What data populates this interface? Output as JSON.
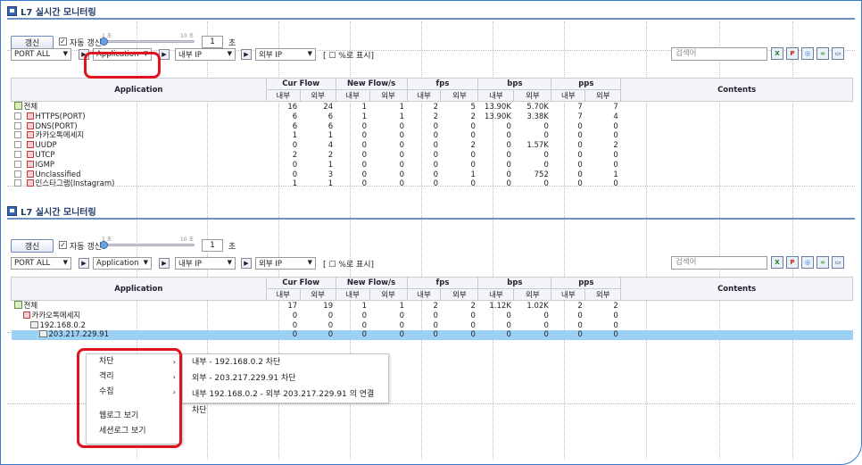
{
  "panel_title": "L7 실시간 모니터링",
  "refresh": {
    "button": "갱신",
    "auto_checkbox": "자동 갱신",
    "slider_min": "1 초",
    "slider_max": "10 초",
    "interval_value": "1",
    "interval_unit": "초"
  },
  "filters": {
    "port": "PORT ALL",
    "application": "Application",
    "internal_ip": "내부 IP",
    "external_ip": "외부 IP",
    "percent_label": "[ ☐ %로 표시]",
    "search_placeholder": "검색어"
  },
  "table_headers": {
    "application": "Application",
    "cur_flow": "Cur Flow",
    "new_flow": "New Flow/s",
    "fps": "fps",
    "bps": "bps",
    "pps": "pps",
    "contents": "Contents",
    "internal": "내부",
    "external": "외부"
  },
  "top_rows": [
    {
      "name": "전체",
      "cells": [
        "16",
        "24",
        "1",
        "1",
        "2",
        "5",
        "13.90K",
        "5.70K",
        "7",
        "7"
      ]
    },
    {
      "name": "HTTPS(PORT)",
      "cells": [
        "6",
        "6",
        "1",
        "1",
        "2",
        "2",
        "13.90K",
        "3.38K",
        "7",
        "4"
      ]
    },
    {
      "name": "DNS(PORT)",
      "cells": [
        "6",
        "6",
        "0",
        "0",
        "0",
        "0",
        "0",
        "0",
        "0",
        "0"
      ]
    },
    {
      "name": "카카오톡메세지",
      "cells": [
        "1",
        "1",
        "0",
        "0",
        "0",
        "0",
        "0",
        "0",
        "0",
        "0"
      ]
    },
    {
      "name": "UUDP",
      "cells": [
        "0",
        "4",
        "0",
        "0",
        "0",
        "2",
        "0",
        "1.57K",
        "0",
        "2"
      ]
    },
    {
      "name": "UTCP",
      "cells": [
        "2",
        "2",
        "0",
        "0",
        "0",
        "0",
        "0",
        "0",
        "0",
        "0"
      ]
    },
    {
      "name": "IGMP",
      "cells": [
        "0",
        "1",
        "0",
        "0",
        "0",
        "0",
        "0",
        "0",
        "0",
        "0"
      ]
    },
    {
      "name": "Unclassified",
      "cells": [
        "0",
        "3",
        "0",
        "0",
        "0",
        "1",
        "0",
        "752",
        "0",
        "1"
      ]
    },
    {
      "name": "인스타그램(Instagram)",
      "cells": [
        "1",
        "1",
        "0",
        "0",
        "0",
        "0",
        "0",
        "0",
        "0",
        "0"
      ]
    }
  ],
  "bottom_rows": [
    {
      "name": "전체",
      "cells": [
        "17",
        "19",
        "1",
        "1",
        "2",
        "2",
        "1.12K",
        "1.02K",
        "2",
        "2"
      ]
    },
    {
      "name": "카카오톡메세지",
      "cells": [
        "0",
        "0",
        "0",
        "0",
        "0",
        "0",
        "0",
        "0",
        "0",
        "0"
      ]
    },
    {
      "name": "192.168.0.2",
      "cells": [
        "0",
        "0",
        "0",
        "0",
        "0",
        "0",
        "0",
        "0",
        "0",
        "0"
      ]
    },
    {
      "name": "203.217.229.91",
      "cells": [
        "0",
        "0",
        "0",
        "0",
        "0",
        "0",
        "0",
        "0",
        "0",
        "0"
      ]
    }
  ],
  "context_menu": {
    "block": "차단",
    "isolate": "격리",
    "collect": "수집",
    "web_log": "웹로그 보기",
    "session_log": "세션로그 보기"
  },
  "block_submenu": {
    "internal": "내부 - 192.168.0.2 차단",
    "external": "외부 - 203.217.229.91 차단",
    "connection": "내부 192.168.0.2 - 외부 203.217.229.91 의 연결 차단"
  },
  "colors": {
    "highlight": "#e0141e",
    "selected_row": "#9dd0f5",
    "title_rule": "#6d90c5"
  }
}
